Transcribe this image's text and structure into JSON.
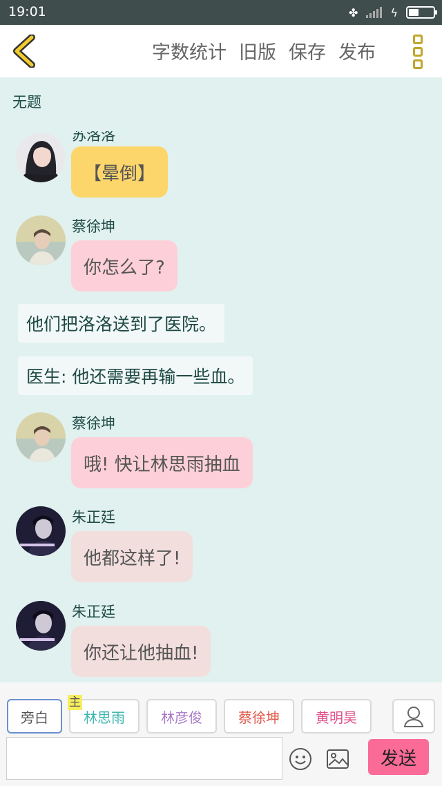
{
  "status_bar": {
    "time": "19:01"
  },
  "header": {
    "actions": [
      "字数统计",
      "旧版",
      "保存",
      "发布"
    ]
  },
  "doc": {
    "title": "无题"
  },
  "messages": [
    {
      "type": "char",
      "name": "苏洛洛",
      "text": "【晕倒】",
      "bubble_color": "#fdd66b",
      "avatar": "avatar-woman"
    },
    {
      "type": "char",
      "name": "蔡徐坤",
      "text": "你怎么了?",
      "bubble_color": "#fdd0d9",
      "avatar": "avatar-beach"
    },
    {
      "type": "narration",
      "text": "他们把洛洛送到了医院。"
    },
    {
      "type": "narration",
      "text": "医生: 他还需要再输一些血。"
    },
    {
      "type": "char",
      "name": "蔡徐坤",
      "text": "哦! 快让林思雨抽血",
      "bubble_color": "#fdd0d9",
      "avatar": "avatar-beach"
    },
    {
      "type": "char",
      "name": "朱正廷",
      "text": "他都这样了!",
      "bubble_color": "#f3dede",
      "avatar": "avatar-dark"
    },
    {
      "type": "char",
      "name": "朱正廷",
      "text": "你还让他抽血!",
      "bubble_color": "#f3dede",
      "avatar": "avatar-dark"
    }
  ],
  "composer": {
    "host_tag": "主",
    "characters": [
      {
        "label": "旁白",
        "color": "#555555"
      },
      {
        "label": "林思雨",
        "color": "#3fb6b0"
      },
      {
        "label": "林彦俊",
        "color": "#a879c9"
      },
      {
        "label": "蔡徐坤",
        "color": "#e0584a"
      },
      {
        "label": "黄明昊",
        "color": "#e0508a"
      }
    ],
    "input_value": "",
    "send_label": "发送"
  },
  "colors": {
    "accent": "#fb6b98",
    "background": "#e0f1ef",
    "back_icon": "#e8c42c"
  }
}
